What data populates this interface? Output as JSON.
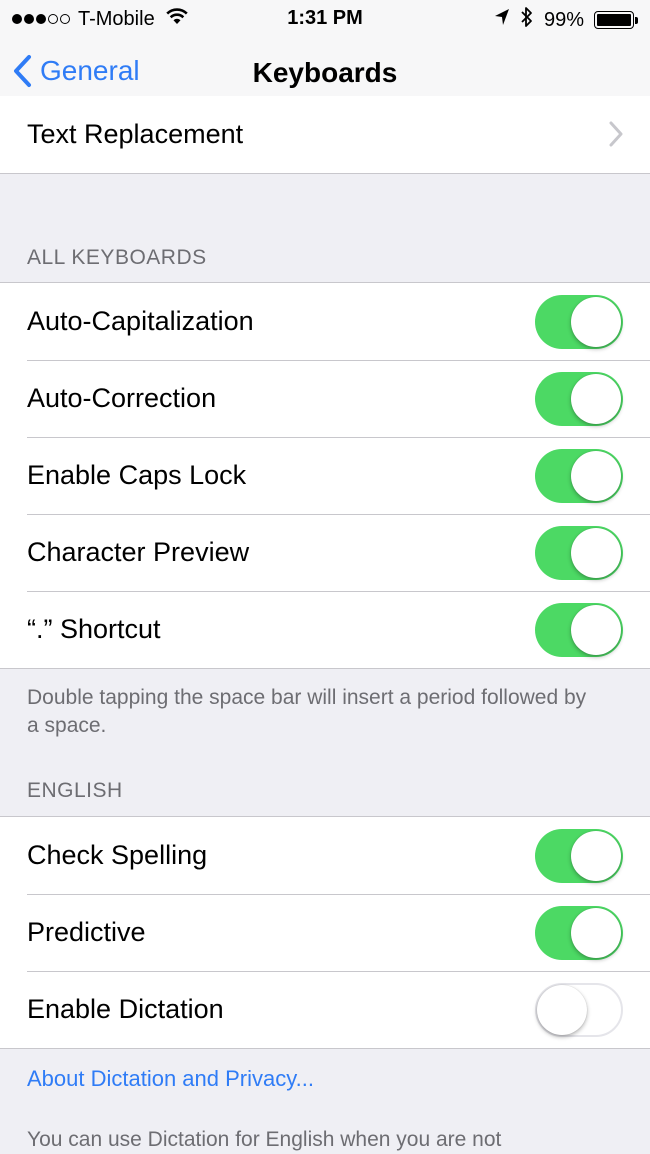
{
  "status_bar": {
    "carrier": "T-Mobile",
    "time": "1:31 PM",
    "battery_percent": "99%",
    "battery_level": 0.99,
    "signal_bars_filled": 3,
    "signal_bars_total": 5,
    "icons": [
      "wifi-icon",
      "location-icon",
      "bluetooth-icon",
      "battery-icon"
    ]
  },
  "nav": {
    "back_label": "General",
    "title": "Keyboards",
    "accent_color": "#2f7cf6"
  },
  "rows_top": [
    {
      "label": "Text Replacement",
      "has_chevron": true
    }
  ],
  "all_keyboards": {
    "header": "ALL KEYBOARDS",
    "items": [
      {
        "label": "Auto-Capitalization",
        "on": true
      },
      {
        "label": "Auto-Correction",
        "on": true
      },
      {
        "label": "Enable Caps Lock",
        "on": true
      },
      {
        "label": "Character Preview",
        "on": true
      },
      {
        "label": "“.” Shortcut",
        "on": true
      }
    ],
    "footer": "Double tapping the space bar will insert a period followed by a space."
  },
  "english": {
    "header": "ENGLISH",
    "items": [
      {
        "label": "Check Spelling",
        "on": true
      },
      {
        "label": "Predictive",
        "on": true
      },
      {
        "label": "Enable Dictation",
        "on": false
      }
    ],
    "link": "About Dictation and Privacy...",
    "footer": "You can use Dictation for English when you are not"
  },
  "colors": {
    "toggle_on": "#4cd964",
    "background": "#efeff4",
    "separator": "#c8c7cc",
    "secondary_text": "#6d6d72"
  }
}
